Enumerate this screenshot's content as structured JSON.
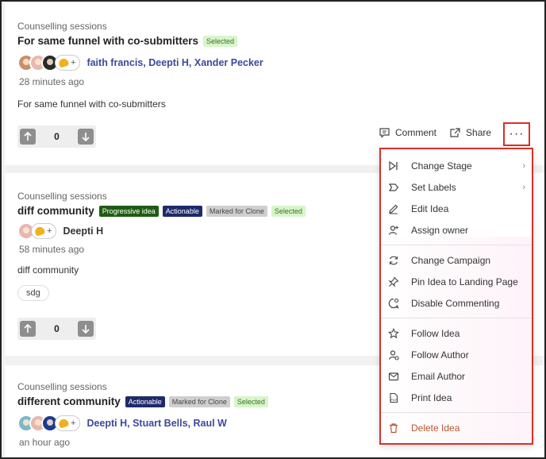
{
  "cards": [
    {
      "context": "Counselling sessions",
      "title": "For same funnel with co-submitters",
      "badges": [
        "Selected"
      ],
      "plus": "+",
      "authors": "faith francis, Deepti H, Xander Pecker",
      "time": "28 minutes ago",
      "body": "For same funnel with co-submitters",
      "votes": "0"
    },
    {
      "context": "Counselling sessions",
      "title": "diff community",
      "badges": [
        "Progressive idea",
        "Actionable",
        "Marked for Clone",
        "Selected"
      ],
      "plus": "+",
      "authors": "Deepti H",
      "time": "58 minutes ago",
      "body": "diff community",
      "tag": "sdg",
      "votes": "0"
    },
    {
      "context": "Counselling sessions",
      "title": "different community",
      "badges": [
        "Actionable",
        "Marked for Clone",
        "Selected"
      ],
      "plus": "+",
      "authors": "Deepti H, Stuart Bells, Raul W",
      "time": "an hour ago"
    }
  ],
  "actions": {
    "comment": "Comment",
    "share": "Share",
    "more": "···"
  },
  "menu": {
    "items": [
      {
        "label": "Change Stage",
        "icon": "skip-forward-icon",
        "submenu": "›"
      },
      {
        "label": "Set Labels",
        "icon": "label-tag-icon",
        "submenu": "›"
      },
      {
        "label": "Edit Idea",
        "icon": "pencil-icon"
      },
      {
        "label": "Assign owner",
        "icon": "user-plus-icon"
      },
      {
        "label": "Change Campaign",
        "icon": "refresh-icon"
      },
      {
        "label": "Pin Idea to Landing Page",
        "icon": "pin-icon"
      },
      {
        "label": "Disable Commenting",
        "icon": "comment-off-icon"
      },
      {
        "label": "Follow Idea",
        "icon": "star-icon"
      },
      {
        "label": "Follow Author",
        "icon": "user-follow-icon"
      },
      {
        "label": "Email Author",
        "icon": "mail-icon"
      },
      {
        "label": "Print Idea",
        "icon": "pdf-icon",
        "icon_text": "PDF"
      },
      {
        "label": "Delete Idea",
        "icon": "trash-icon"
      }
    ]
  },
  "colors": {
    "highlight_border": "#d9302a",
    "author_link": "#3a4a9c",
    "delete_text": "#b5562f"
  }
}
